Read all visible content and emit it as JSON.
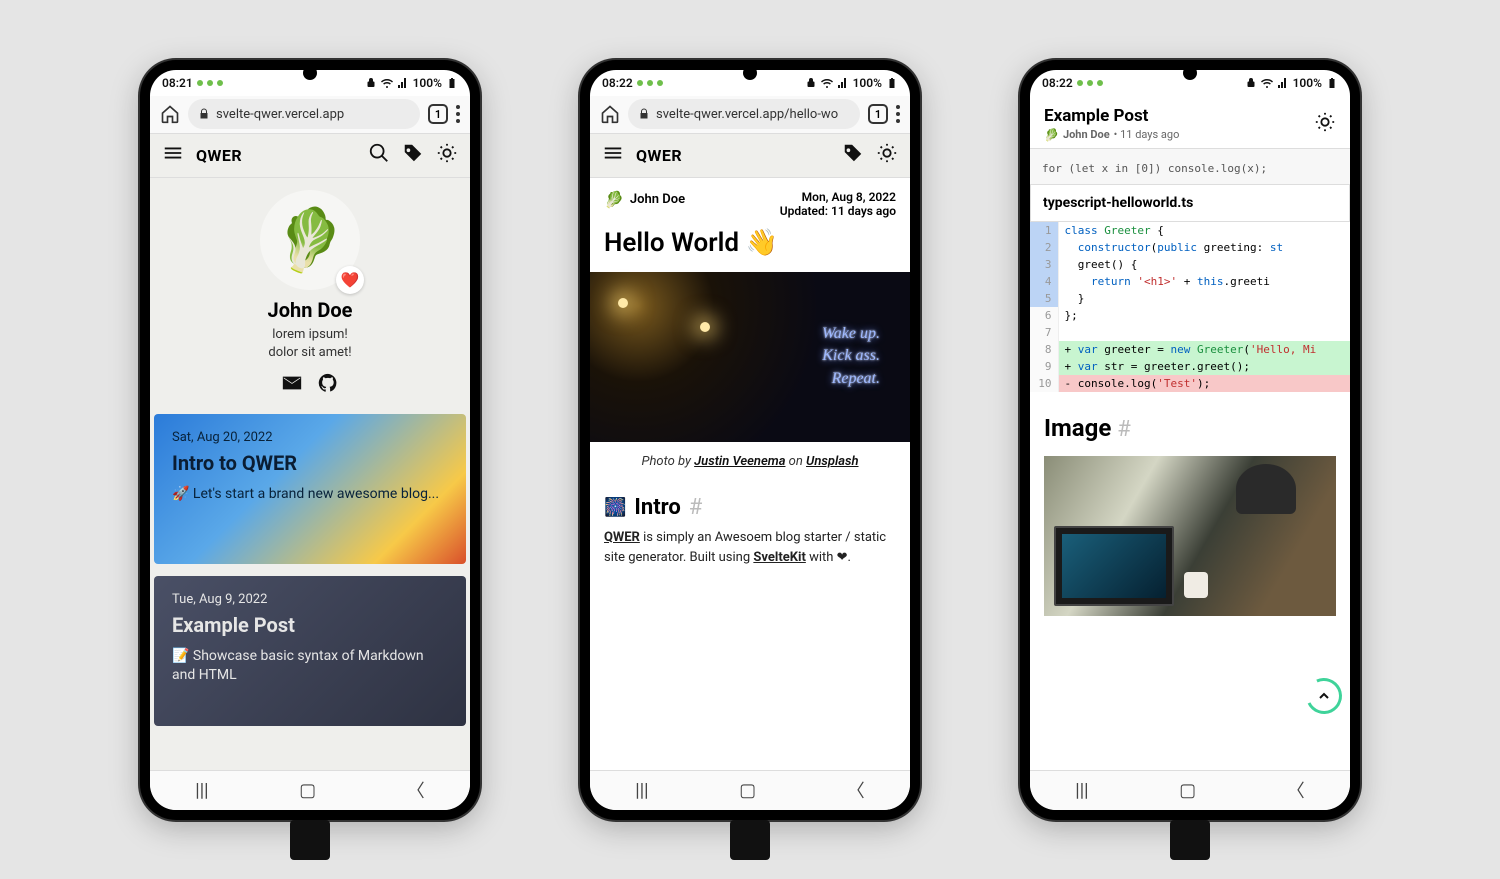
{
  "status": {
    "time1": "08:21",
    "time2": "08:22",
    "time3": "08:22",
    "battery": "100%"
  },
  "addr": {
    "url1": "svelte-qwer.vercel.app",
    "url2": "svelte-qwer.vercel.app/hello-wo",
    "tabCount": "1"
  },
  "header": {
    "title": "QWER"
  },
  "profile": {
    "name": "John Doe",
    "bio1": "lorem ipsum!",
    "bio2": "dolor sit amet!"
  },
  "posts": [
    {
      "date": "Sat, Aug 20, 2022",
      "title": "Intro to QWER",
      "summary": "🚀 Let's start a brand new awesome blog..."
    },
    {
      "date": "Tue, Aug 9, 2022",
      "title": "Example Post",
      "summary": "📝 Showcase basic syntax of Markdown and HTML"
    }
  ],
  "post2": {
    "author": "John Doe",
    "date": "Mon, Aug 8, 2022",
    "updated": "Updated: 11 days ago",
    "title": "Hello World 👋",
    "neon1": "Wake up.",
    "neon2": "Kick ass.",
    "neon3": "Repeat.",
    "captionPrefix": "Photo by ",
    "captionAuthor": "Justin Veenema",
    "captionMid": " on ",
    "captionSite": "Unsplash",
    "sectionTitle": "Intro",
    "body1": "QWER",
    "body2": " is simply an Awesoem blog starter / static site generator. Built using ",
    "body3": "SvelteKit",
    "body4": " with ❤."
  },
  "post3": {
    "title": "Example Post",
    "author": "John Doe",
    "ago": "• 11 days ago",
    "snippet": "for (let x in [0]) console.log(x);",
    "filename": "typescript-helloworld.ts",
    "lines": [
      {
        "n": "1",
        "html": "<span class='kw'>class</span> <span class='cls'>Greeter</span> {"
      },
      {
        "n": "2",
        "html": "&nbsp;&nbsp;<span class='kw'>constructor</span>(<span class='kw'>public</span> greeting: <span class='kw'>st</span>"
      },
      {
        "n": "3",
        "html": "&nbsp;&nbsp;greet() {"
      },
      {
        "n": "4",
        "html": "&nbsp;&nbsp;&nbsp;&nbsp;<span class='kw'>return</span> <span class='str'>'&lt;h1&gt;'</span> + <span class='this'>this</span>.greeti"
      },
      {
        "n": "5",
        "html": "&nbsp;&nbsp;}"
      },
      {
        "n": "6",
        "html": "};"
      },
      {
        "n": "7",
        "html": ""
      },
      {
        "n": "8",
        "cls": "row-add",
        "html": "+ <span class='kw'>var</span> greeter = <span class='kw'>new</span> <span class='cls'>Greeter</span>(<span class='str'>'Hello, Mi</span>"
      },
      {
        "n": "9",
        "cls": "row-add",
        "html": "+ <span class='kw'>var</span> str = greeter.greet();"
      },
      {
        "n": "10",
        "cls": "row-del",
        "html": "- console.log(<span class='str'>'Test'</span>);"
      }
    ],
    "imageHeading": "Image"
  }
}
